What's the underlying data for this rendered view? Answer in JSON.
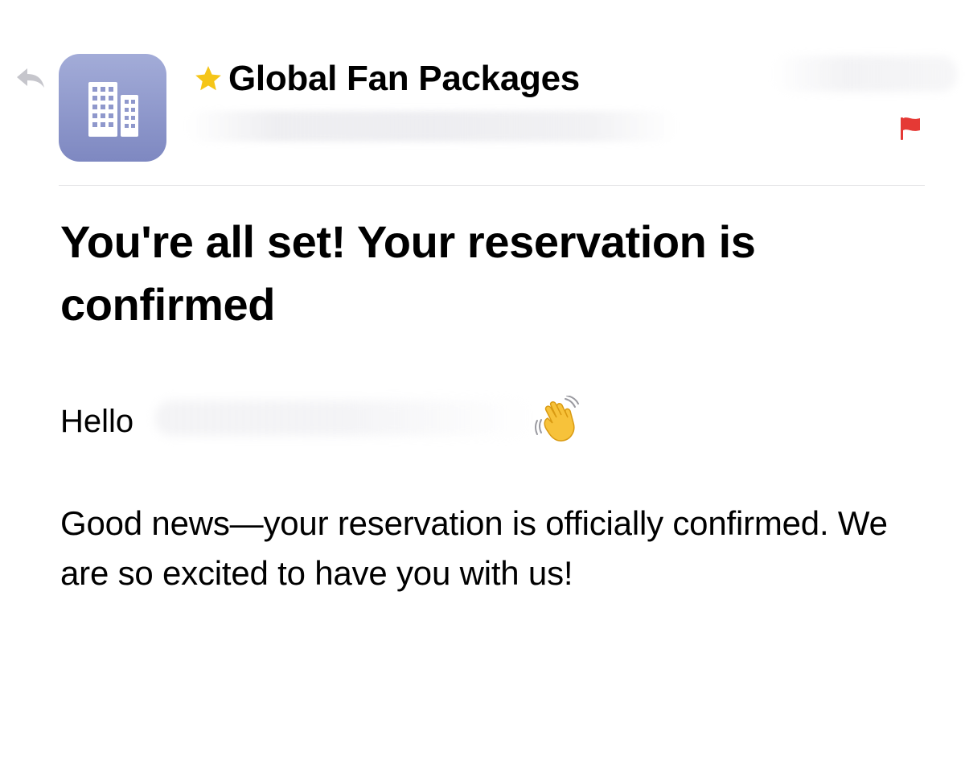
{
  "header": {
    "sender_name": "Global Fan Packages",
    "starred": true,
    "flagged": true,
    "avatar_icon": "building-icon",
    "reply_icon": "reply-arrow-icon",
    "colors": {
      "avatar": "#8f98cc",
      "star": "#f5c518",
      "flag": "#e53935"
    }
  },
  "message": {
    "headline": "You're all set! Your reservation is confirmed",
    "greeting": "Hello",
    "greeting_emoji": "waving-hand-icon",
    "paragraph": "Good news—your reservation is officially confirmed. We are so excited to have you with us!"
  }
}
